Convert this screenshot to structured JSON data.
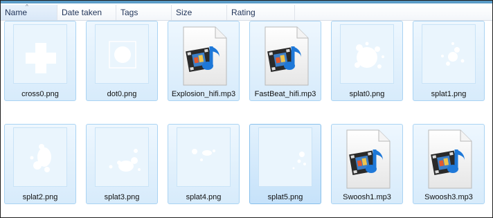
{
  "columns": [
    {
      "label": "Name",
      "sorted": true
    },
    {
      "label": "Date taken"
    },
    {
      "label": "Tags"
    },
    {
      "label": "Size"
    },
    {
      "label": "Rating"
    }
  ],
  "sort_indicator": "^",
  "files": [
    {
      "name": "cross0.png",
      "kind": "image",
      "art": "cross"
    },
    {
      "name": "dot0.png",
      "kind": "image",
      "art": "dot"
    },
    {
      "name": "Explosion_hifi.mp3",
      "kind": "audio"
    },
    {
      "name": "FastBeat_hifi.mp3",
      "kind": "audio"
    },
    {
      "name": "splat0.png",
      "kind": "image",
      "art": "splat0"
    },
    {
      "name": "splat1.png",
      "kind": "image",
      "art": "splat1"
    },
    {
      "name": "splat2.png",
      "kind": "image",
      "art": "splat2"
    },
    {
      "name": "splat3.png",
      "kind": "image",
      "art": "splat3"
    },
    {
      "name": "splat4.png",
      "kind": "image",
      "art": "splat4"
    },
    {
      "name": "splat5.png",
      "kind": "image",
      "art": "splat5",
      "highlighted": true
    },
    {
      "name": "Swoosh1.mp3",
      "kind": "audio"
    },
    {
      "name": "Swoosh3.mp3",
      "kind": "audio"
    }
  ],
  "colors": {
    "accent": "#5a9bc7",
    "tile_border": "#a9d3f3",
    "music_note": "#1e78d8"
  }
}
